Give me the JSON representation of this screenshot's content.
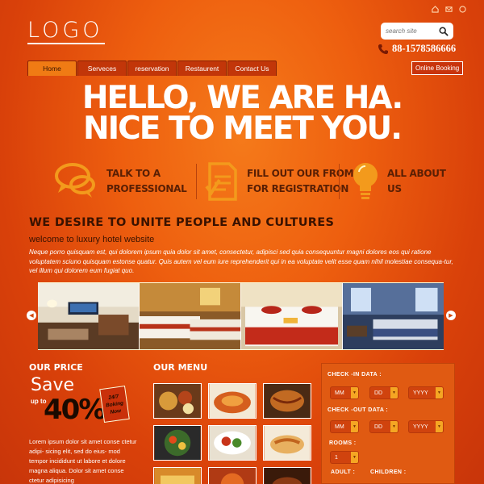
{
  "header": {
    "logo": "LOGO",
    "search_placeholder": "search site",
    "phone": "88-1578586666",
    "online_booking": "Online Booking"
  },
  "nav": {
    "items": [
      "Home",
      "Serveces",
      "reservation",
      "Restaurent",
      "Contact Us"
    ]
  },
  "hero": {
    "line1": "HELLO, WE ARE HA.",
    "line2": "NICE TO MEET YOU."
  },
  "features": [
    {
      "line1": "TALK TO A",
      "line2": "PROFESSIONAL",
      "icon": "chat-bubbles-icon"
    },
    {
      "line1": "FILL OUT OUR FROM",
      "line2": "FOR REGISTRATION",
      "icon": "form-icon"
    },
    {
      "line1": "ALL ABOUT",
      "line2": "US",
      "icon": "lightbulb-icon"
    }
  ],
  "intro": {
    "title": "WE DESIRE TO UNITE PEOPLE AND CULTURES",
    "subtitle": "welcome to luxury hotel website",
    "body": "Neque porro quisquam est, qui dolorem ipsum quia dolor sit amet, consectetur, adipisci sed quia consequuntur magni dolores eos qui ratione voluptatem sciuno quisquam estonse quatur. Quis autem vel eum iure reprehenderit qui in ea voluptate velit esse quam nihil molestiae consequa-tur, vel illum qui dolorem eum fugiat quo."
  },
  "price": {
    "title": "OUR PRICE",
    "save": "Save",
    "upto": "up to",
    "percent": "40%",
    "tag": "24/7 Boking Now",
    "body": "Lorem ipsum dolor sit amet conse ctetur adipi- sicing elit, sed do eius- mod tempor incididunt ut labore et dolore magna aliqua. Dolor sit amet conse ctetur adipisicing"
  },
  "menu": {
    "title": "OUR MENU"
  },
  "booking": {
    "checkin_label": "CHECK -IN DATA :",
    "checkout_label": "CHECK -OUT DATA :",
    "month": "MM",
    "day": "DD",
    "year": "YYYY",
    "rooms_label": "ROOMS :",
    "rooms_value": "1",
    "adult_label": "ADULT :",
    "children_label": "CHILDREN :"
  }
}
